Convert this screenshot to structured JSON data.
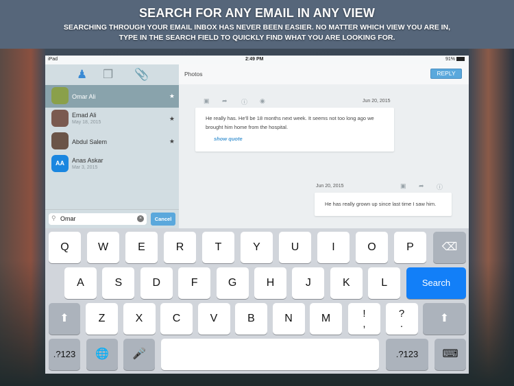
{
  "banner": {
    "title": "SEARCH FOR ANY EMAIL IN ANY VIEW",
    "line1": "SEARCHING THROUGH YOUR EMAIL INBOX HAS NEVER BEEN EASIER. NO MATTER WHICH VIEW YOU ARE IN,",
    "line2": "TYPE IN THE SEARCH FIELD TO QUICKLY FIND WHAT YOU ARE LOOKING FOR."
  },
  "status": {
    "device": "iPad",
    "time": "2:49 PM",
    "battery": "91%"
  },
  "sidebar": {
    "tabs": [
      "person-icon",
      "conversations-icon",
      "attachment-icon"
    ],
    "contacts": [
      {
        "name": "Omar Ali",
        "date": "",
        "starred": true,
        "selected": true,
        "avatar_color": "#8aa04a"
      },
      {
        "name": "Emad Ali",
        "date": "May 18, 2015",
        "starred": true,
        "selected": false,
        "avatar_color": "#7a5a50"
      },
      {
        "name": "Abdul Salem",
        "date": "",
        "starred": true,
        "selected": false,
        "avatar_color": "#6a5448"
      },
      {
        "name": "Anas Askar",
        "date": "Mar 3, 2015",
        "starred": false,
        "selected": false,
        "initials": "AA",
        "avatar_color": "#1a86e0"
      }
    ],
    "search": {
      "value": "Omar",
      "cancel": "Cancel"
    }
  },
  "main": {
    "title": "Photos",
    "reply": "REPLY",
    "messages": [
      {
        "date": "Jun 20, 2015",
        "text_line1": "He really has. He'll be 18 months next week. It seems not too long ago we",
        "text_line2": "brought him home from the hospital.",
        "show_quote": "show quote"
      },
      {
        "date": "Jun 20, 2015",
        "text": "He has really grown up since last time I saw him."
      }
    ]
  },
  "keyboard": {
    "row1": [
      "Q",
      "W",
      "E",
      "R",
      "T",
      "Y",
      "U",
      "I",
      "O",
      "P"
    ],
    "row2": [
      "A",
      "S",
      "D",
      "F",
      "G",
      "H",
      "J",
      "K",
      "L"
    ],
    "row3": [
      "Z",
      "X",
      "C",
      "V",
      "B",
      "N",
      "M"
    ],
    "punct": [
      {
        "top": "!",
        "bottom": ","
      },
      {
        "top": "?",
        "bottom": "."
      }
    ],
    "search": "Search",
    "numbers": ".?123",
    "accent": "#127ff8"
  }
}
